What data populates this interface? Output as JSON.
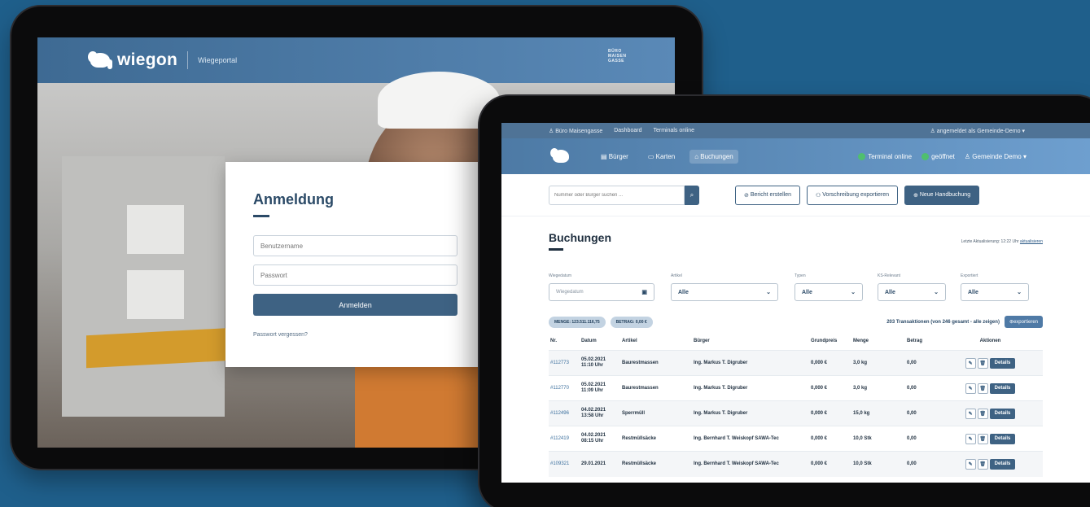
{
  "login_app": {
    "brand": "wiegon",
    "portal_label": "Wiegeportal",
    "buro_badge": "BÜRO MAISEN GASSE",
    "card_title": "Anmeldung",
    "username_placeholder": "Benutzername",
    "password_placeholder": "Passwort",
    "login_button": "Anmelden",
    "forgot_link": "Passwort vergessen?"
  },
  "bookings_app": {
    "topbar": {
      "office": "Büro Maisengasse",
      "dashboard": "Dashboard",
      "terminals": "Terminals online",
      "logged_in": "angemeldet als Gemeinde-Demo"
    },
    "nav": {
      "items": [
        "Bürger",
        "Karten",
        "Buchungen"
      ],
      "terminal_status": "Terminal online",
      "open_status": "geöffnet",
      "user": "Gemeinde Demo"
    },
    "toolbar": {
      "search_placeholder": "Nummer oder Bürger suchen ...",
      "report_button": "Bericht erstellen",
      "export_prescription_button": "Vorschreibung exportieren",
      "new_booking_button": "Neue Handbuchung"
    },
    "page_title": "Buchungen",
    "last_update_prefix": "Letzte Aktualisierung: 12:22 Uhr",
    "last_update_link": "aktualisieren",
    "filters": {
      "wiegedatum_label": "Wiegedatum",
      "wiegedatum_placeholder": "Wiegedatum",
      "artikel_label": "Artikel",
      "artikel_value": "Alle",
      "typen_label": "Typen",
      "typen_value": "Alle",
      "ks_label": "KS-Relevant",
      "ks_value": "Alle",
      "exportiert_label": "Exportiert",
      "exportiert_value": "Alle"
    },
    "stats": {
      "menge": "MENGE: 123.511.116,75",
      "betrag": "BETRAG: 0,00 €",
      "transactions": "203 Transaktionen (von 246 gesamt - alle zeigen)",
      "export_button": "exportieren"
    },
    "table": {
      "headers": [
        "Nr.",
        "Datum",
        "Artikel",
        "Bürger",
        "Grundpreis",
        "Menge",
        "Betrag",
        "Aktionen"
      ],
      "rows": [
        {
          "nr": "#112773",
          "date": "05.02.2021",
          "time": "11:10 Uhr",
          "artikel": "Baurestmassen",
          "buerger": "Ing. Markus T. Digruber",
          "grundpreis": "0,000 €",
          "menge": "3,0 kg",
          "betrag": "0,00",
          "details": "Details"
        },
        {
          "nr": "#112770",
          "date": "05.02.2021",
          "time": "11:09 Uhr",
          "artikel": "Baurestmassen",
          "buerger": "Ing. Markus T. Digruber",
          "grundpreis": "0,000 €",
          "menge": "3,0 kg",
          "betrag": "0,00",
          "details": "Details"
        },
        {
          "nr": "#112496",
          "date": "04.02.2021",
          "time": "13:58 Uhr",
          "artikel": "Sperrmüll",
          "buerger": "Ing. Markus T. Digruber",
          "grundpreis": "0,000 €",
          "menge": "15,0 kg",
          "betrag": "0,00",
          "details": "Details"
        },
        {
          "nr": "#112419",
          "date": "04.02.2021",
          "time": "08:15 Uhr",
          "artikel": "Restmüllsäcke",
          "buerger": "Ing. Bernhard T. Weiskopf SAWA-Tec",
          "grundpreis": "0,000 €",
          "menge": "10,0 Stk",
          "betrag": "0,00",
          "details": "Details"
        },
        {
          "nr": "#109321",
          "date": "29.01.2021",
          "time": "",
          "artikel": "Restmüllsäcke",
          "buerger": "Ing. Bernhard T. Weiskopf SAWA-Tec",
          "grundpreis": "0,000 €",
          "menge": "10,0 Stk",
          "betrag": "0,00",
          "details": "Details"
        }
      ]
    }
  },
  "colors": {
    "background": "#1f5f8b",
    "header_blue": "#4d7aa5",
    "primary_button": "#3e6283",
    "status_green": "#4fbf6e"
  }
}
